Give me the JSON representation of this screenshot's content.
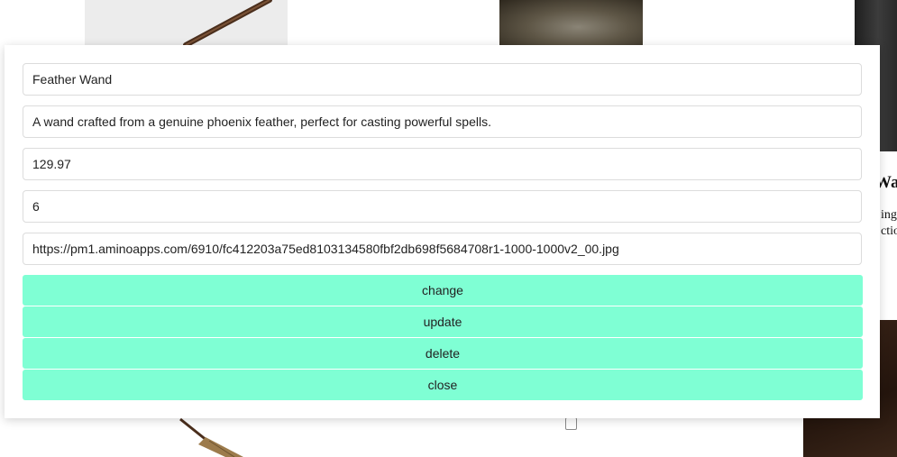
{
  "background": {
    "side_title": "Wan",
    "side_text_lines": [
      "ing",
      "ctio"
    ]
  },
  "form": {
    "name": "Feather Wand",
    "description": "A wand crafted from a genuine phoenix feather, perfect for casting powerful spells.",
    "price": "129.97",
    "quantity": "6",
    "image_url": "https://pm1.aminoapps.com/6910/fc412203a75ed8103134580fbf2db698f5684708r1-1000-1000v2_00.jpg"
  },
  "buttons": {
    "change": "change",
    "update": "update",
    "delete": "delete",
    "close": "close"
  },
  "colors": {
    "button_bg": "#7fffd4"
  }
}
